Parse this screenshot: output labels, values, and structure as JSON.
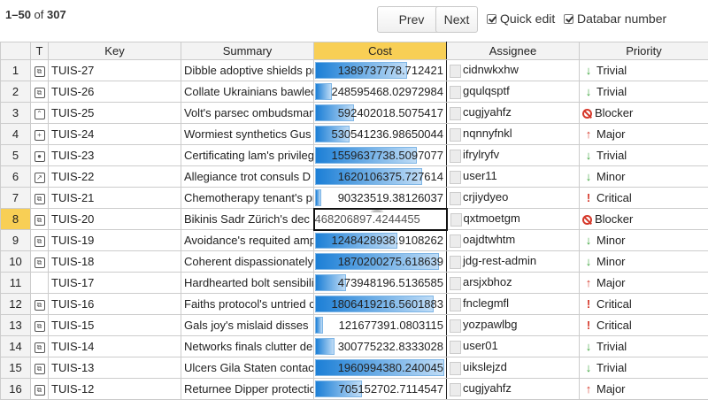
{
  "pager": {
    "range": "1–50",
    "of_text": "of",
    "total": "307"
  },
  "toolbar": {
    "prev_label": "Prev",
    "next_label": "Next",
    "quick_edit_label": "Quick edit",
    "databar_label": "Databar number"
  },
  "columns": [
    "T",
    "Key",
    "Summary",
    "Cost",
    "Assignee",
    "Priority"
  ],
  "rows": [
    {
      "num": "1",
      "type": "subtask",
      "key": "TUIS-27",
      "summary": "Dibble adoptive shields pr",
      "cost": "1389737778.712421",
      "bar": 0.71,
      "assignee": "cidnwkxhw",
      "priority": "Trivial"
    },
    {
      "num": "2",
      "type": "subtask",
      "key": "TUIS-26",
      "summary": "Collate Ukrainians bawled",
      "cost": "248595468.02972984",
      "bar": 0.13,
      "assignee": "gqulqsptf",
      "priority": "Trivial"
    },
    {
      "num": "3",
      "type": "improvement",
      "key": "TUIS-25",
      "summary": "Volt's parsec ombudsman",
      "cost": "592402018.5075417",
      "bar": 0.3,
      "assignee": "cugjyahfz",
      "priority": "Blocker"
    },
    {
      "num": "4",
      "type": "new-feature",
      "key": "TUIS-24",
      "summary": "Wormiest synthetics Gus",
      "cost": "530541236.98650044",
      "bar": 0.27,
      "assignee": "nqnnyfnkl",
      "priority": "Major"
    },
    {
      "num": "5",
      "type": "bug",
      "key": "TUIS-23",
      "summary": "Certificating lam's privileg",
      "cost": "1559637738.5097077",
      "bar": 0.79,
      "assignee": "ifrylryfv",
      "priority": "Trivial"
    },
    {
      "num": "6",
      "type": "link",
      "key": "TUIS-22",
      "summary": "Allegiance trot consuls D",
      "cost": "1620106375.727614",
      "bar": 0.83,
      "assignee": "user11",
      "priority": "Minor"
    },
    {
      "num": "7",
      "type": "subtask",
      "key": "TUIS-21",
      "summary": "Chemotherapy tenant's pr",
      "cost": "90323519.38126037",
      "bar": 0.05,
      "assignee": "crjiydyeo",
      "priority": "Critical"
    },
    {
      "num": "8",
      "type": "subtask",
      "key": "TUIS-20",
      "summary": "Bikinis Sadr Zürich's dec",
      "cost": "468206897.4244455",
      "bar": 0.0,
      "assignee": "qxtmoetgm",
      "priority": "Blocker",
      "editing": true
    },
    {
      "num": "9",
      "type": "subtask",
      "key": "TUIS-19",
      "summary": "Avoidance's requited amp",
      "cost": "1248428938.9108262",
      "bar": 0.64,
      "assignee": "oajdtwhtm",
      "priority": "Minor"
    },
    {
      "num": "10",
      "type": "subtask",
      "key": "TUIS-18",
      "summary": "Coherent dispassionately",
      "cost": "1870200275.618639",
      "bar": 0.96,
      "assignee": "jdg-rest-admin",
      "priority": "Minor"
    },
    {
      "num": "11",
      "type": "",
      "key": "TUIS-17",
      "summary": "Hardhearted bolt sensibili",
      "cost": "473948196.5136585",
      "bar": 0.24,
      "assignee": "arsjxbhoz",
      "priority": "Major"
    },
    {
      "num": "12",
      "type": "subtask",
      "key": "TUIS-16",
      "summary": "Faiths protocol's untried c",
      "cost": "1806419216.5601883",
      "bar": 0.92,
      "assignee": "fnclegmfl",
      "priority": "Critical"
    },
    {
      "num": "13",
      "type": "subtask",
      "key": "TUIS-15",
      "summary": "Gals joy's mislaid disses",
      "cost": "121677391.0803115",
      "bar": 0.06,
      "assignee": "yozpawlbg",
      "priority": "Critical"
    },
    {
      "num": "14",
      "type": "subtask",
      "key": "TUIS-14",
      "summary": "Networks finals clutter de",
      "cost": "300775232.8333028",
      "bar": 0.15,
      "assignee": "user01",
      "priority": "Trivial"
    },
    {
      "num": "15",
      "type": "subtask",
      "key": "TUIS-13",
      "summary": "Ulcers Gila Staten contac",
      "cost": "1960994380.240045",
      "bar": 1.0,
      "assignee": "uikslejzd",
      "priority": "Trivial"
    },
    {
      "num": "16",
      "type": "subtask",
      "key": "TUIS-12",
      "summary": "Returnee Dipper protectio",
      "cost": "705152702.7114547",
      "bar": 0.36,
      "assignee": "cugjyahfz",
      "priority": "Major"
    }
  ],
  "priority_icons": {
    "Trivial": "arrow-down-icon",
    "Minor": "arrow-down-icon",
    "Major": "arrow-up-icon",
    "Critical": "exclamation-icon",
    "Blocker": "blocker-icon"
  },
  "colors": {
    "accent": "#f8cf55",
    "databar": "#1c7fd6",
    "trivial_minor": "#3aa33a",
    "major_critical_blocker": "#d6392b"
  }
}
